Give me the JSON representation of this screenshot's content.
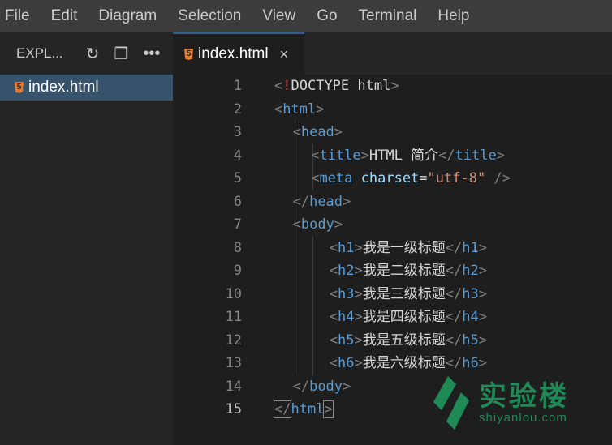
{
  "menu": [
    "File",
    "Edit",
    "Diagram",
    "Selection",
    "View",
    "Go",
    "Terminal",
    "Help"
  ],
  "explorer": {
    "title": "EXPL...",
    "file": "index.html",
    "icons": [
      "refresh-icon",
      "collapse-all-icon",
      "more-icon"
    ]
  },
  "tab": {
    "label": "index.html",
    "close": "×"
  },
  "current_line": 15,
  "lines": [
    {
      "n": "1",
      "indent": 0,
      "tokens": [
        [
          "br",
          "<"
        ],
        [
          "ex",
          "!"
        ],
        [
          "dt",
          "DOCTYPE html"
        ],
        [
          "br",
          ">"
        ]
      ]
    },
    {
      "n": "2",
      "indent": 0,
      "tokens": [
        [
          "br",
          "<"
        ],
        [
          "tag",
          "html"
        ],
        [
          "br",
          ">"
        ]
      ]
    },
    {
      "n": "3",
      "indent": 2,
      "tokens": [
        [
          "br",
          "<"
        ],
        [
          "tag",
          "head"
        ],
        [
          "br",
          ">"
        ]
      ]
    },
    {
      "n": "4",
      "indent": 4,
      "tokens": [
        [
          "br",
          "<"
        ],
        [
          "tag",
          "title"
        ],
        [
          "br",
          ">"
        ],
        [
          "txt",
          "HTML 简介"
        ],
        [
          "br",
          "</"
        ],
        [
          "tag",
          "title"
        ],
        [
          "br",
          ">"
        ]
      ]
    },
    {
      "n": "5",
      "indent": 4,
      "tokens": [
        [
          "br",
          "<"
        ],
        [
          "tag",
          "meta"
        ],
        [
          "txt",
          " "
        ],
        [
          "attr",
          "charset"
        ],
        [
          "txt",
          "="
        ],
        [
          "str",
          "\"utf-8\""
        ],
        [
          "txt",
          " "
        ],
        [
          "br",
          "/>"
        ]
      ]
    },
    {
      "n": "6",
      "indent": 2,
      "tokens": [
        [
          "br",
          "</"
        ],
        [
          "tag",
          "head"
        ],
        [
          "br",
          ">"
        ]
      ]
    },
    {
      "n": "7",
      "indent": 2,
      "tokens": [
        [
          "br",
          "<"
        ],
        [
          "tag",
          "body"
        ],
        [
          "br",
          ">"
        ]
      ]
    },
    {
      "n": "8",
      "indent": 6,
      "tokens": [
        [
          "br",
          "<"
        ],
        [
          "tag",
          "h1"
        ],
        [
          "br",
          ">"
        ],
        [
          "txt",
          "我是一级标题"
        ],
        [
          "br",
          "</"
        ],
        [
          "tag",
          "h1"
        ],
        [
          "br",
          ">"
        ]
      ]
    },
    {
      "n": "9",
      "indent": 6,
      "tokens": [
        [
          "br",
          "<"
        ],
        [
          "tag",
          "h2"
        ],
        [
          "br",
          ">"
        ],
        [
          "txt",
          "我是二级标题"
        ],
        [
          "br",
          "</"
        ],
        [
          "tag",
          "h2"
        ],
        [
          "br",
          ">"
        ]
      ]
    },
    {
      "n": "10",
      "indent": 6,
      "tokens": [
        [
          "br",
          "<"
        ],
        [
          "tag",
          "h3"
        ],
        [
          "br",
          ">"
        ],
        [
          "txt",
          "我是三级标题"
        ],
        [
          "br",
          "</"
        ],
        [
          "tag",
          "h3"
        ],
        [
          "br",
          ">"
        ]
      ]
    },
    {
      "n": "11",
      "indent": 6,
      "tokens": [
        [
          "br",
          "<"
        ],
        [
          "tag",
          "h4"
        ],
        [
          "br",
          ">"
        ],
        [
          "txt",
          "我是四级标题"
        ],
        [
          "br",
          "</"
        ],
        [
          "tag",
          "h4"
        ],
        [
          "br",
          ">"
        ]
      ]
    },
    {
      "n": "12",
      "indent": 6,
      "tokens": [
        [
          "br",
          "<"
        ],
        [
          "tag",
          "h5"
        ],
        [
          "br",
          ">"
        ],
        [
          "txt",
          "我是五级标题"
        ],
        [
          "br",
          "</"
        ],
        [
          "tag",
          "h5"
        ],
        [
          "br",
          ">"
        ]
      ]
    },
    {
      "n": "13",
      "indent": 6,
      "tokens": [
        [
          "br",
          "<"
        ],
        [
          "tag",
          "h6"
        ],
        [
          "br",
          ">"
        ],
        [
          "txt",
          "我是六级标题"
        ],
        [
          "br",
          "</"
        ],
        [
          "tag",
          "h6"
        ],
        [
          "br",
          ">"
        ]
      ]
    },
    {
      "n": "14",
      "indent": 2,
      "tokens": [
        [
          "br",
          "</"
        ],
        [
          "tag",
          "body"
        ],
        [
          "br",
          ">"
        ]
      ]
    },
    {
      "n": "15",
      "indent": 0,
      "tokens": [
        [
          "br",
          "</"
        ],
        [
          "tag",
          "html"
        ],
        [
          "br",
          ">"
        ]
      ]
    }
  ],
  "watermark": {
    "name": "实验楼",
    "url": "shiyanlou.com",
    "color": "#1f8a55"
  }
}
